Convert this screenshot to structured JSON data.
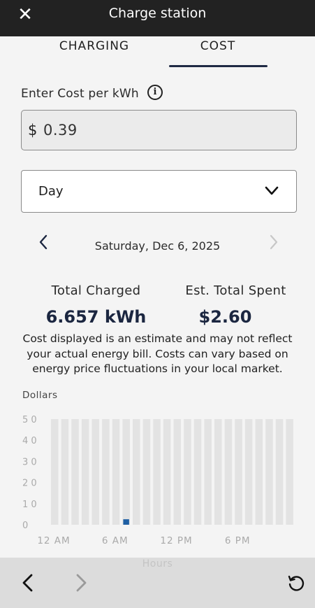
{
  "window": {
    "title": "Charge station"
  },
  "tabs": [
    {
      "label": "CHARGING",
      "active": false
    },
    {
      "label": "COST",
      "active": true
    }
  ],
  "cost": {
    "label": "Enter Cost per kWh",
    "currency": "$",
    "value": "0.39"
  },
  "period": {
    "selected": "Day"
  },
  "date": {
    "text": "Saturday, Dec 6, 2025"
  },
  "stats": {
    "charged_label": "Total Charged",
    "charged_value": "6.657 kWh",
    "spent_label": "Est. Total Spent",
    "spent_value": "$2.60"
  },
  "disclaimer": "Cost displayed is an estimate and may not reflect your actual energy bill. Costs can vary based on energy price fluctuations in your local market.",
  "chart_data": {
    "type": "bar",
    "ylabel": "Dollars",
    "xlabel": "Hours",
    "ylim": [
      0,
      50
    ],
    "yticks": [
      0,
      10,
      20,
      30,
      40,
      50
    ],
    "x_tick_labels": [
      "12 AM",
      "6 AM",
      "12 PM",
      "6 PM"
    ],
    "x_tick_hours": [
      0,
      6,
      12,
      18
    ],
    "categories": [
      0,
      1,
      2,
      3,
      4,
      5,
      6,
      7,
      8,
      9,
      10,
      11,
      12,
      13,
      14,
      15,
      16,
      17,
      18,
      19,
      20,
      21,
      22,
      23
    ],
    "values": [
      0,
      0,
      0,
      0,
      0,
      0,
      0,
      2.6,
      0,
      0,
      0,
      0,
      0,
      0,
      0,
      0,
      0,
      0,
      0,
      0,
      0,
      0,
      0,
      0
    ],
    "grid": false,
    "colors": {
      "bar": "#1f5fa3",
      "background_bar": "#e3e3e3"
    }
  },
  "colors": {
    "accent": "#1b2640",
    "title_bar": "#222222"
  }
}
